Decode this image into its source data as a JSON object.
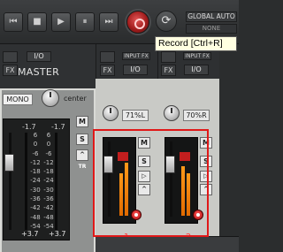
{
  "transport": {
    "buttons": [
      {
        "name": "goto-start-button",
        "icon": "skip-back-icon",
        "glyph": "⏮"
      },
      {
        "name": "stop-button",
        "icon": "stop-icon",
        "glyph": "■"
      },
      {
        "name": "play-button",
        "icon": "play-icon",
        "glyph": "▶"
      },
      {
        "name": "pause-button",
        "icon": "pause-icon",
        "glyph": "⏸"
      },
      {
        "name": "goto-end-button",
        "icon": "skip-forward-icon",
        "glyph": "⏭"
      }
    ],
    "record_icon": "record-icon",
    "loop_icon": "repeat-icon",
    "loop_glyph": "⟳",
    "global_auto": "GLOBAL AUTO",
    "global_none": "NONE"
  },
  "tooltip": "Record [Ctrl+R]",
  "master": {
    "fx": "FX",
    "io": "I/O",
    "label": "MASTER",
    "mono": "MONO",
    "pan": "center",
    "peak_left": "-1.7",
    "peak_right": "-1.7",
    "scale": [
      "6",
      "0",
      "-6",
      "-12",
      "-18",
      "-24",
      "-30",
      "-36",
      "-42",
      "-48",
      "-54",
      "-60"
    ],
    "vol_left": "+3.7",
    "vol_right": "+3.7",
    "side_buttons": {
      "m": "M",
      "s": "S",
      "tr": "TR"
    }
  },
  "tracks": [
    {
      "number": "1",
      "input_fx": "INPUT FX",
      "fx": "FX",
      "io": "I/O",
      "pan": "71%L",
      "m": "M",
      "s": "S"
    },
    {
      "number": "2",
      "input_fx": "INPUT FX",
      "fx": "FX",
      "io": "I/O",
      "pan": "70%R",
      "m": "M",
      "s": "S"
    }
  ],
  "colors": {
    "accent_red": "#e01818",
    "meter_orange": "#ff8c00"
  }
}
